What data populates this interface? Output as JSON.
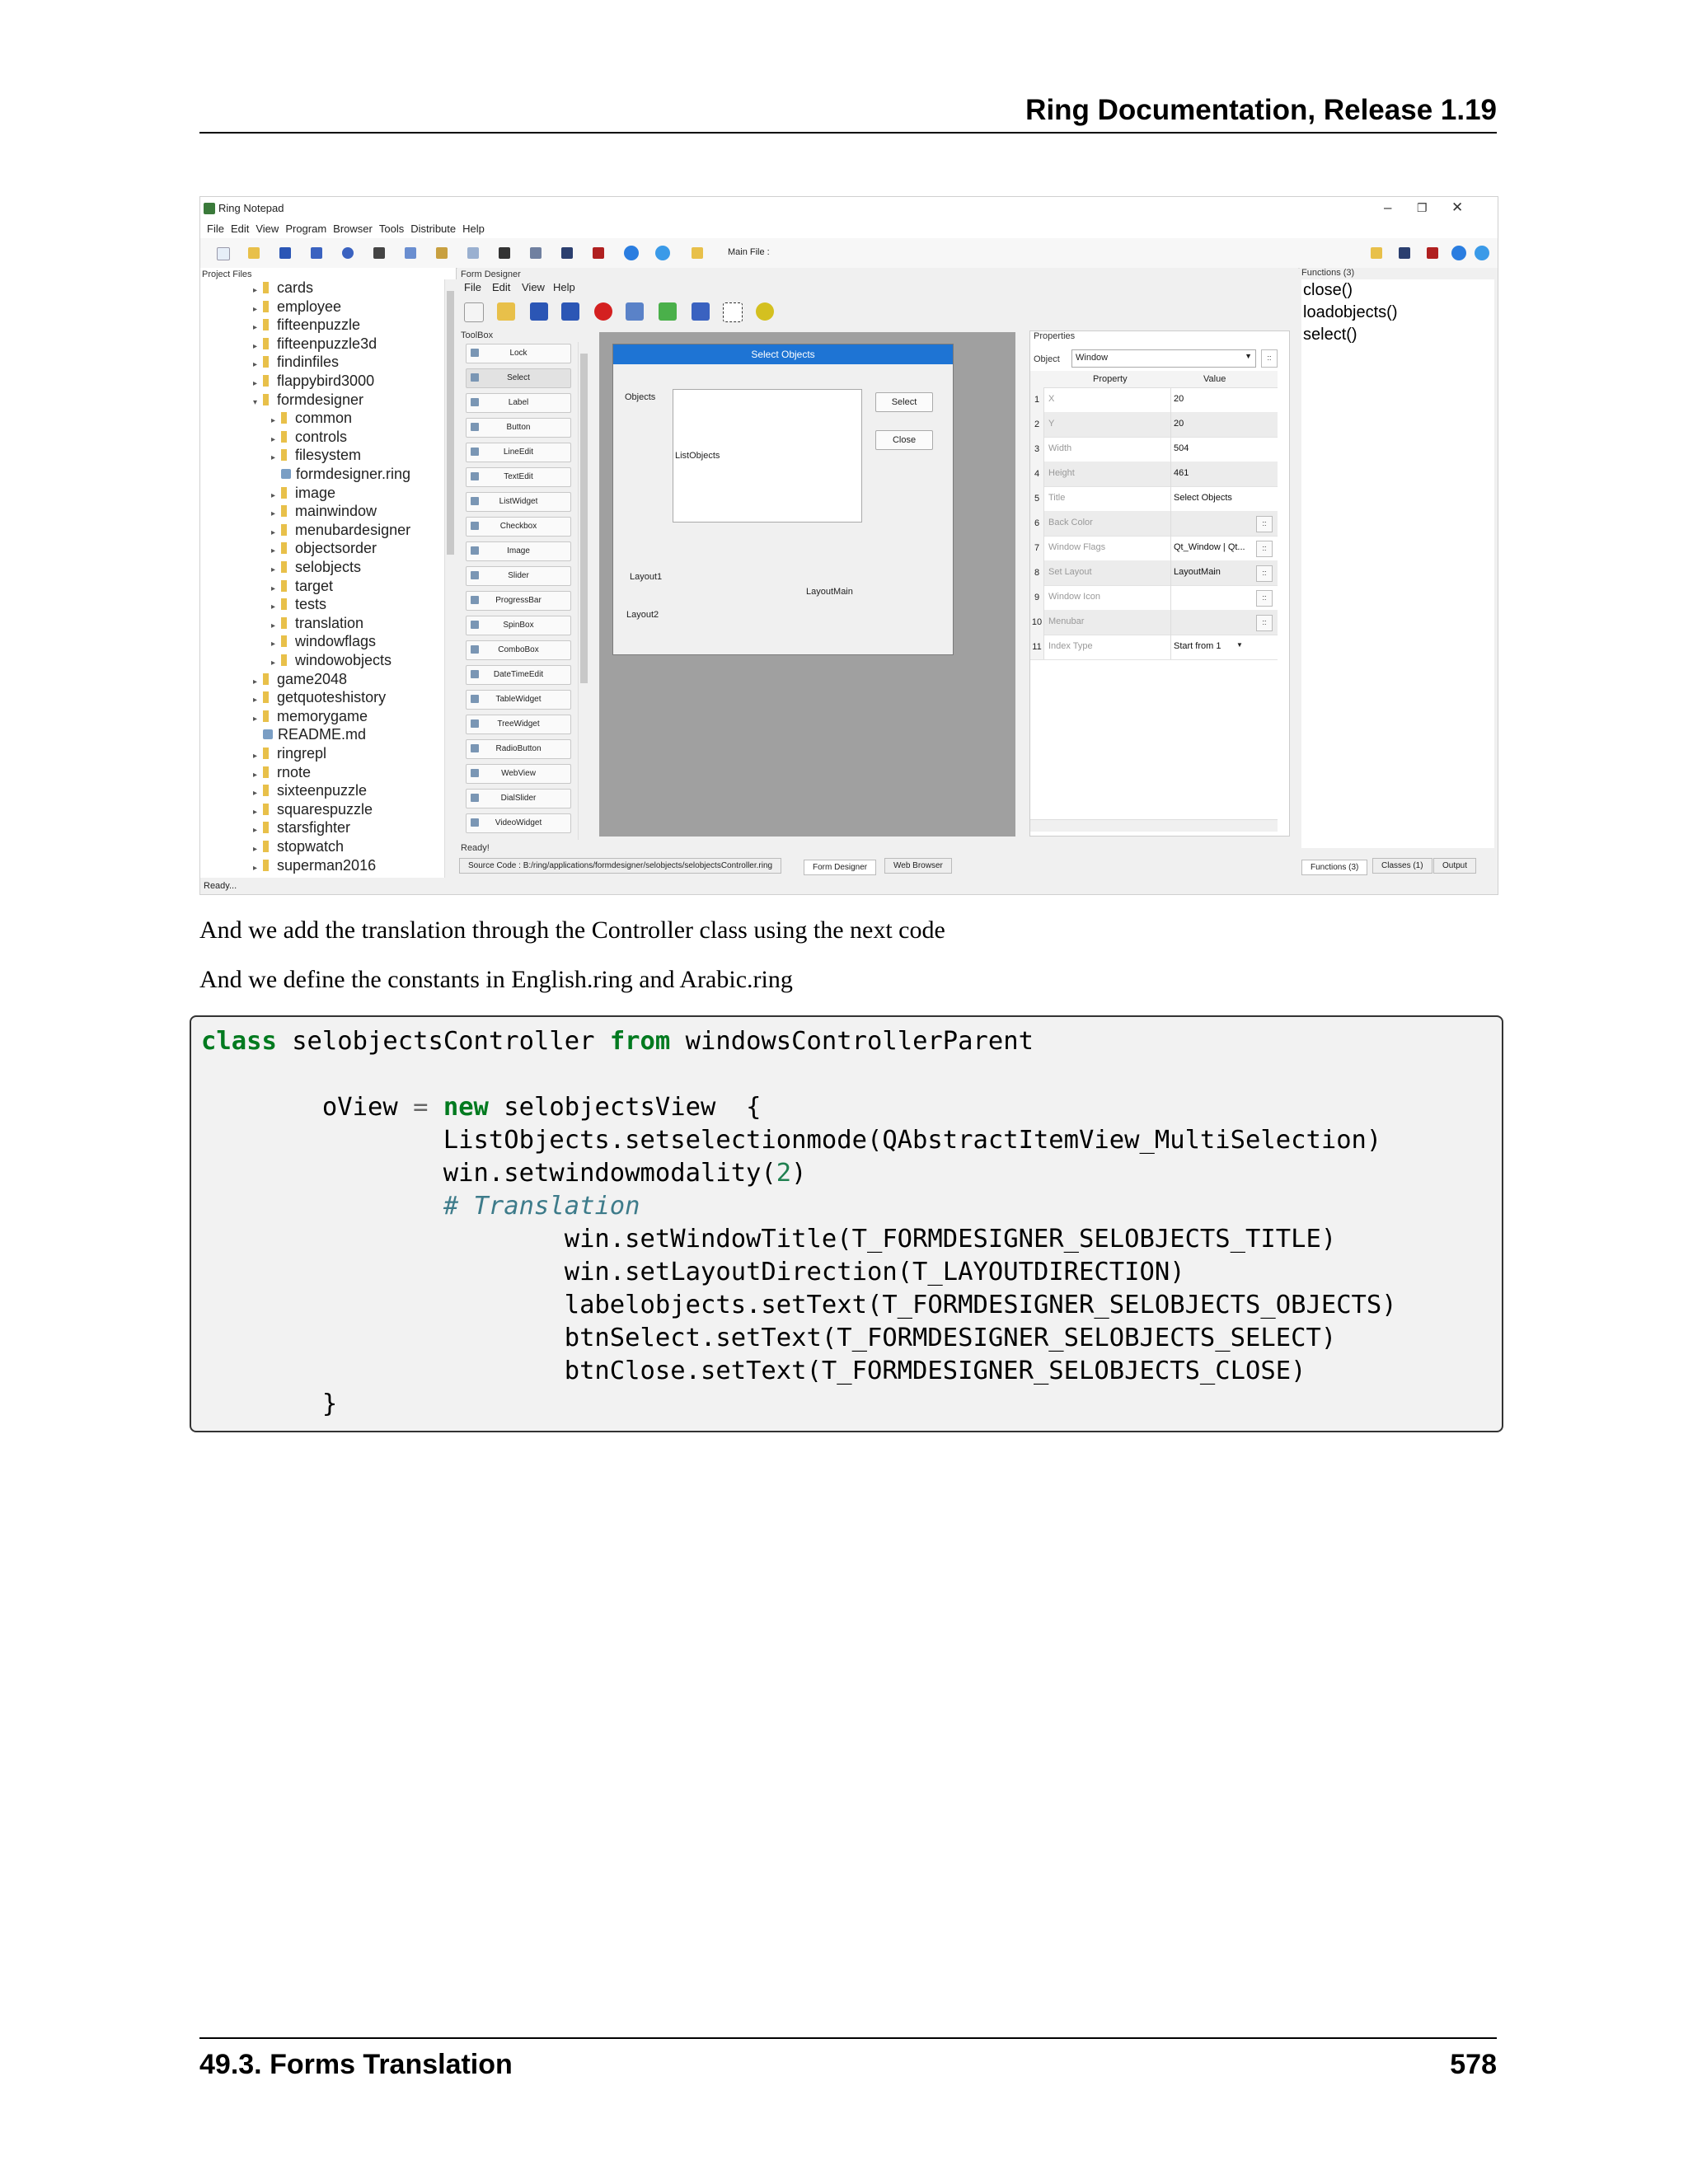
{
  "header": {
    "title": "Ring Documentation, Release 1.19"
  },
  "screenshot": {
    "window_title": "Ring Notepad",
    "window_controls": [
      "–",
      "❐",
      "✕"
    ],
    "menu": [
      "File",
      "Edit",
      "View",
      "Program",
      "Browser",
      "Tools",
      "Distribute",
      "Help"
    ],
    "main_file_label": "Main File :",
    "project_files": {
      "title": "Project Files",
      "items": [
        {
          "label": "cards",
          "type": "folder",
          "level": 1,
          "arrow": "▸"
        },
        {
          "label": "employee",
          "type": "folder",
          "level": 1,
          "arrow": "▸"
        },
        {
          "label": "fifteenpuzzle",
          "type": "folder",
          "level": 1,
          "arrow": "▸"
        },
        {
          "label": "fifteenpuzzle3d",
          "type": "folder",
          "level": 1,
          "arrow": "▸"
        },
        {
          "label": "findinfiles",
          "type": "folder",
          "level": 1,
          "arrow": "▸"
        },
        {
          "label": "flappybird3000",
          "type": "folder",
          "level": 1,
          "arrow": "▸"
        },
        {
          "label": "formdesigner",
          "type": "folder",
          "level": 1,
          "arrow": "▾"
        },
        {
          "label": "common",
          "type": "folder",
          "level": 2,
          "arrow": "▸"
        },
        {
          "label": "controls",
          "type": "folder",
          "level": 2,
          "arrow": "▸"
        },
        {
          "label": "filesystem",
          "type": "folder",
          "level": 2,
          "arrow": "▸"
        },
        {
          "label": "formdesigner.ring",
          "type": "file",
          "level": 2,
          "arrow": ""
        },
        {
          "label": "image",
          "type": "folder",
          "level": 2,
          "arrow": "▸"
        },
        {
          "label": "mainwindow",
          "type": "folder",
          "level": 2,
          "arrow": "▸"
        },
        {
          "label": "menubardesigner",
          "type": "folder",
          "level": 2,
          "arrow": "▸"
        },
        {
          "label": "objectsorder",
          "type": "folder",
          "level": 2,
          "arrow": "▸"
        },
        {
          "label": "selobjects",
          "type": "folder",
          "level": 2,
          "arrow": "▸"
        },
        {
          "label": "target",
          "type": "folder",
          "level": 2,
          "arrow": "▸"
        },
        {
          "label": "tests",
          "type": "folder",
          "level": 2,
          "arrow": "▸"
        },
        {
          "label": "translation",
          "type": "folder",
          "level": 2,
          "arrow": "▸"
        },
        {
          "label": "windowflags",
          "type": "folder",
          "level": 2,
          "arrow": "▸"
        },
        {
          "label": "windowobjects",
          "type": "folder",
          "level": 2,
          "arrow": "▸"
        },
        {
          "label": "game2048",
          "type": "folder",
          "level": 1,
          "arrow": "▸"
        },
        {
          "label": "getquoteshistory",
          "type": "folder",
          "level": 1,
          "arrow": "▸"
        },
        {
          "label": "memorygame",
          "type": "folder",
          "level": 1,
          "arrow": "▸"
        },
        {
          "label": "README.md",
          "type": "file",
          "level": 1,
          "arrow": ""
        },
        {
          "label": "ringrepl",
          "type": "folder",
          "level": 1,
          "arrow": "▸"
        },
        {
          "label": "rnote",
          "type": "folder",
          "level": 1,
          "arrow": "▸"
        },
        {
          "label": "sixteenpuzzle",
          "type": "folder",
          "level": 1,
          "arrow": "▸"
        },
        {
          "label": "squarespuzzle",
          "type": "folder",
          "level": 1,
          "arrow": "▸"
        },
        {
          "label": "starsfighter",
          "type": "folder",
          "level": 1,
          "arrow": "▸"
        },
        {
          "label": "stopwatch",
          "type": "folder",
          "level": 1,
          "arrow": "▸"
        },
        {
          "label": "superman2016",
          "type": "folder",
          "level": 1,
          "arrow": "▸"
        }
      ]
    },
    "status": "Ready...",
    "form_designer": {
      "title": "Form Designer",
      "menu": [
        "File",
        "Edit",
        "View",
        "Help"
      ],
      "toolbox_title": "ToolBox",
      "tools": [
        "Lock",
        "Select",
        "Label",
        "Button",
        "LineEdit",
        "TextEdit",
        "ListWidget",
        "Checkbox",
        "Image",
        "Slider",
        "ProgressBar",
        "SpinBox",
        "ComboBox",
        "DateTimeEdit",
        "TableWidget",
        "TreeWidget",
        "RadioButton",
        "WebView",
        "DialSlider",
        "VideoWidget"
      ],
      "form": {
        "title": "Select Objects",
        "objects_label": "Objects",
        "list_label": "ListObjects",
        "select_btn": "Select",
        "close_btn": "Close",
        "layout1": "Layout1",
        "layout2": "Layout2",
        "layout_main": "LayoutMain"
      },
      "status": "Ready!",
      "tabs": [
        "Source Code : B:/ring/applications/formdesigner/selobjects/selobjectsController.ring",
        "Form Designer",
        "Web Browser"
      ]
    },
    "properties": {
      "title": "Properties",
      "object_label": "Object",
      "object_value": "Window",
      "col_property": "Property",
      "col_value": "Value",
      "rows": [
        {
          "n": "1",
          "p": "X",
          "v": "20"
        },
        {
          "n": "2",
          "p": "Y",
          "v": "20"
        },
        {
          "n": "3",
          "p": "Width",
          "v": "504"
        },
        {
          "n": "4",
          "p": "Height",
          "v": "461"
        },
        {
          "n": "5",
          "p": "Title",
          "v": "Select Objects"
        },
        {
          "n": "6",
          "p": "Back Color",
          "v": ""
        },
        {
          "n": "7",
          "p": "Window Flags",
          "v": "Qt_Window | Qt..."
        },
        {
          "n": "8",
          "p": "Set Layout",
          "v": "LayoutMain"
        },
        {
          "n": "9",
          "p": "Window Icon",
          "v": ""
        },
        {
          "n": "10",
          "p": "Menubar",
          "v": ""
        },
        {
          "n": "11",
          "p": "Index Type",
          "v": "Start from 1"
        }
      ]
    },
    "functions": {
      "title": "Functions (3)",
      "items": [
        "close()",
        "loadobjects()",
        "select()"
      ],
      "tabs": [
        "Functions (3)",
        "Classes (1)",
        "Output"
      ]
    }
  },
  "paragraphs": [
    "And we add the translation through the Controller class using the next code",
    "And we define the constants in English.ring and Arabic.ring"
  ],
  "code": {
    "l1_kw1": "class",
    "l1_a": " selobjectsController ",
    "l1_kw2": "from",
    "l1_b": " windowsControllerParent",
    "l3_a": "        oView ",
    "l3_op": "=",
    "l3_sp": " ",
    "l3_kw": "new",
    "l3_b": " selobjectsView  {",
    "l4": "                ListObjects.setselectionmode(QAbstractItemView_MultiSelection)",
    "l5_a": "                win.setwindowmodality(",
    "l5_num": "2",
    "l5_b": ")",
    "l6_a": "                ",
    "l6_cm": "# Translation",
    "l7": "                        win.setWindowTitle(T_FORMDESIGNER_SELOBJECTS_TITLE)",
    "l8": "                        win.setLayoutDirection(T_LAYOUTDIRECTION)",
    "l9": "                        labelobjects.setText(T_FORMDESIGNER_SELOBJECTS_OBJECTS)",
    "l10": "                        btnSelect.setText(T_FORMDESIGNER_SELOBJECTS_SELECT)",
    "l11": "                        btnClose.setText(T_FORMDESIGNER_SELOBJECTS_CLOSE)",
    "l12": "        }"
  },
  "footer": {
    "section": "49.3.  Forms Translation",
    "page": "578"
  }
}
